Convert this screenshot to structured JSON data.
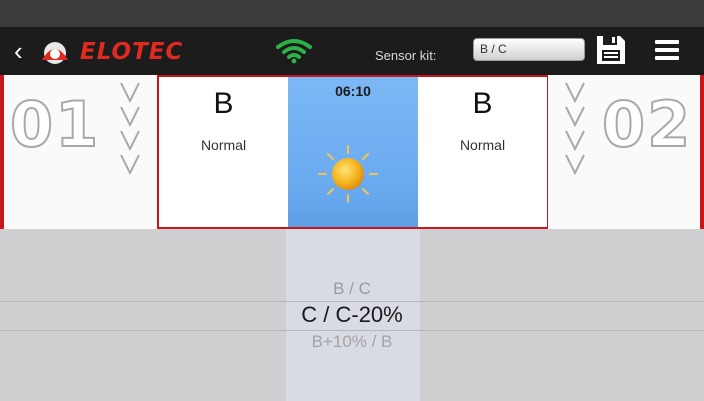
{
  "header": {
    "brand": "ELOTEC",
    "sensor_kit_label": "Sensor kit:",
    "sensor_kit_value": "B / C"
  },
  "zones": {
    "left_number": "01",
    "right_number": "02"
  },
  "sensors": [
    {
      "letter": "B",
      "state": "Normal"
    },
    {
      "letter": "B",
      "state": "Normal"
    }
  ],
  "time_panel": {
    "time": "06:10"
  },
  "picker": {
    "options": [
      "B / C",
      "C / C-20%",
      "B+10% / B"
    ],
    "selected": "C / C-20%"
  },
  "colors": {
    "accent_red": "#c8161d",
    "logo_red": "#e02a1f",
    "wifi_green": "#2bb34a",
    "sky_blue": "#6aabf0",
    "sun": "#f5b51e"
  }
}
